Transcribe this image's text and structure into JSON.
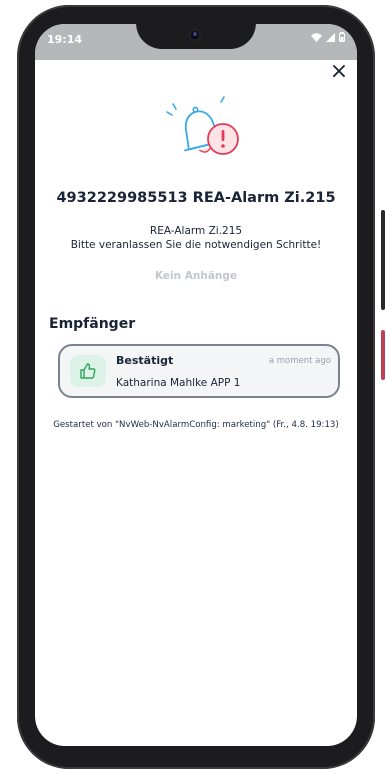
{
  "status_bar": {
    "time": "19:14",
    "icons": [
      "wifi-icon",
      "signal-icon",
      "battery-icon"
    ]
  },
  "dialog": {
    "close_label": "×",
    "title": "4932229985513 REA-Alarm Zi.215",
    "message_line1": "REA-Alarm Zi.215",
    "message_line2": "Bitte veranlassen Sie die notwendigen Schritte!",
    "attachments": "Kein Anhänge"
  },
  "recipients": {
    "heading": "Empfänger",
    "items": [
      {
        "status": "Bestätigt",
        "time": "a moment ago",
        "name": "Katharina Mahlke APP 1",
        "icon": "thumbs-up-icon"
      }
    ]
  },
  "footer": {
    "started_by": "Gestartet von \"NvWeb-NvAlarmConfig: marketing\" (Fr., 4.8. 19:13)"
  },
  "colors": {
    "primary_text": "#1b2436",
    "accent_blue": "#3aa9e8",
    "alert_red": "#e23b53",
    "alert_fill": "#fde3e6",
    "success_fill": "#ddf3e7",
    "success_green": "#2fa360",
    "muted": "#c3c6cb"
  }
}
